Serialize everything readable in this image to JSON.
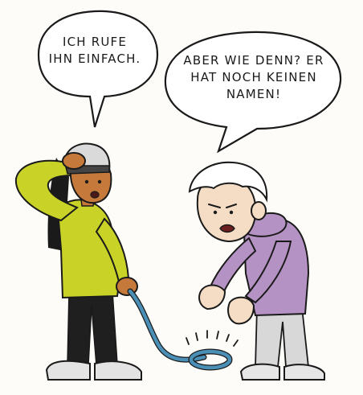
{
  "speech_bubbles": {
    "left": {
      "lines": [
        "ICH RUFE",
        "IHN EINFACH."
      ]
    },
    "right": {
      "lines": [
        "ABER WIE DENN? ER",
        "HAT NOCH KEINEN",
        "NAMEN!"
      ]
    }
  },
  "colors": {
    "jacket": "#c9d327",
    "hoodie": "#b592c4",
    "leash": "#4b8fb7",
    "skin_left": "#c57a3c",
    "skin_right": "#f4dcc5",
    "outline": "#1a1a1a"
  }
}
